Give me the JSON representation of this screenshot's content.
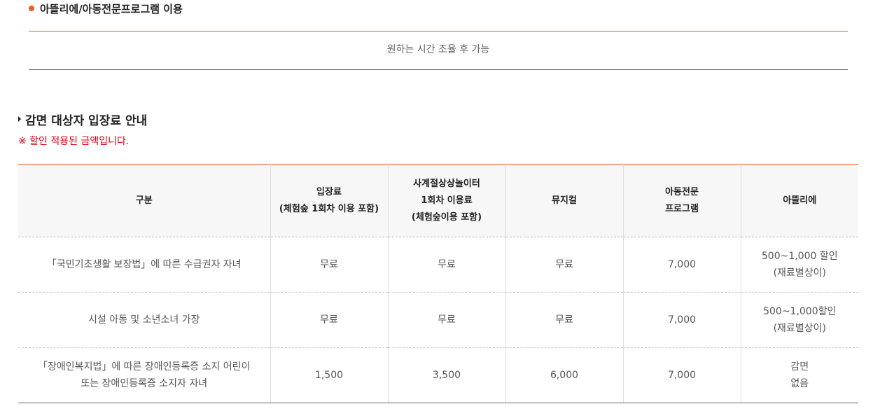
{
  "section1": {
    "title": "아뜰리에/아동전문프로그램 이용",
    "text": "원하는 시간 조율 후 가능"
  },
  "section2": {
    "title": "감면 대상자 입장료 안내",
    "note": "※ 할인 적용된 금액입니다."
  },
  "table": {
    "headers": [
      [
        "구분"
      ],
      [
        "입장료",
        "(체험숲 1회차 이용 포함)"
      ],
      [
        "사계절상상놀이터",
        "1회차 이용료",
        "(체험숲이용 포함)"
      ],
      [
        "뮤지컬"
      ],
      [
        "아동전문",
        "프로그램"
      ],
      [
        "아뜰리에"
      ]
    ],
    "rows": [
      [
        [
          "「국민기초생활 보장법」에 따른 수급권자 자녀"
        ],
        [
          "무료"
        ],
        [
          "무료"
        ],
        [
          "무료"
        ],
        [
          "7,000"
        ],
        [
          "500~1,000 할인",
          "(재료별상이)"
        ]
      ],
      [
        [
          "시설 아동 및 소년소녀 가장"
        ],
        [
          "무료"
        ],
        [
          "무료"
        ],
        [
          "무료"
        ],
        [
          "7,000"
        ],
        [
          "500~1,000할인",
          "(재료별상이)"
        ]
      ],
      [
        [
          "「장애인복지법」에 따른 장애인등록증 소지 어린이",
          "또는 장애인등록증 소지자 자녀"
        ],
        [
          "1,500"
        ],
        [
          "3,500"
        ],
        [
          "6,000"
        ],
        [
          "7,000"
        ],
        [
          "감면",
          "없음"
        ]
      ]
    ]
  }
}
